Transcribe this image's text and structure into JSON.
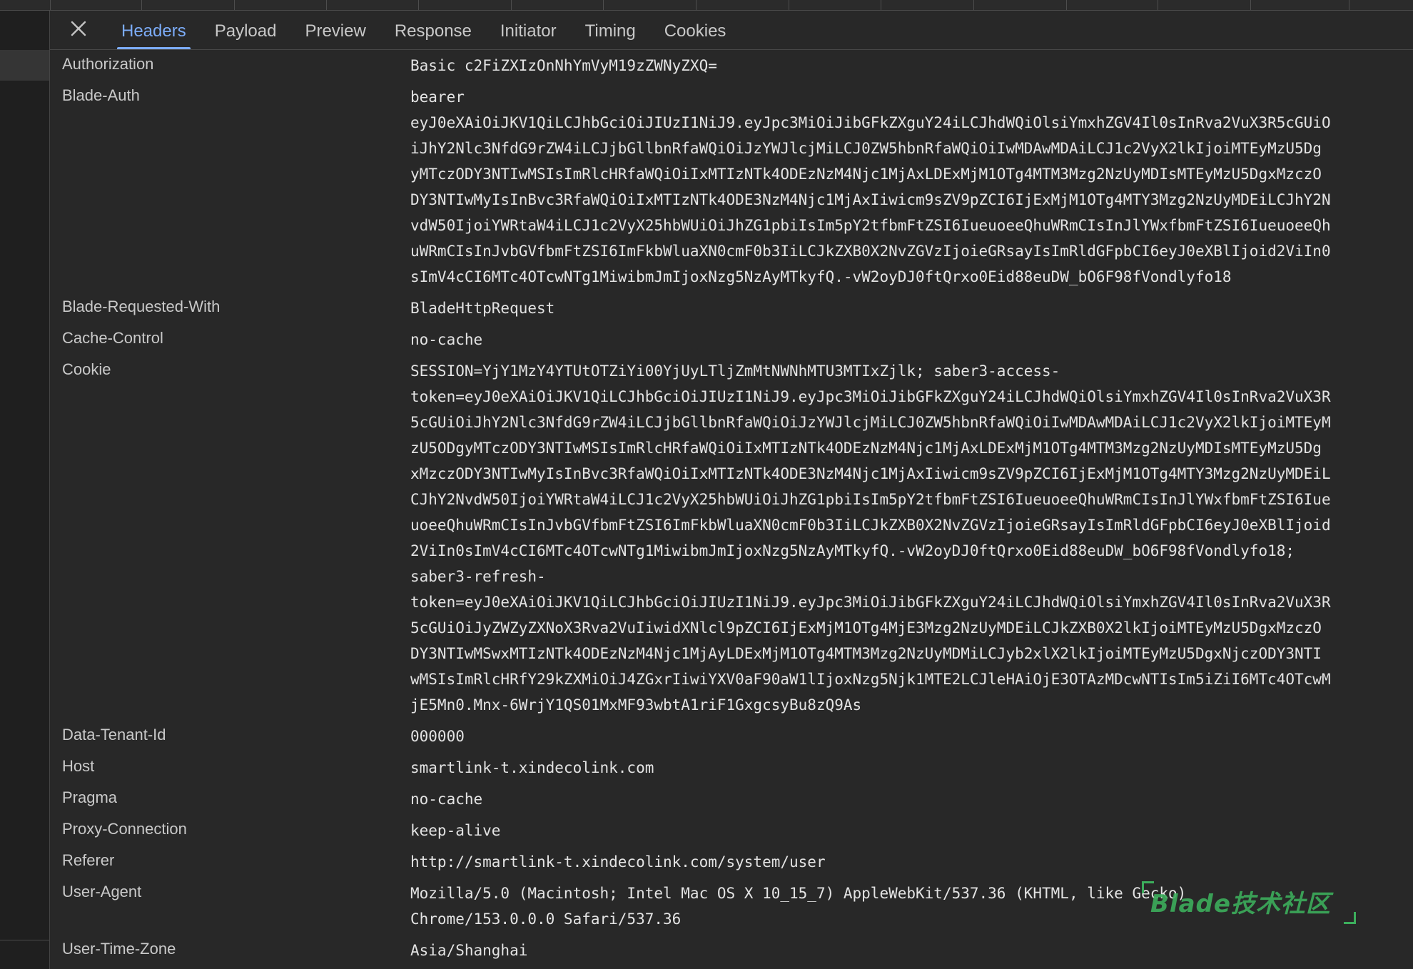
{
  "tabs": {
    "close_label": "×",
    "items": [
      {
        "label": "Headers",
        "active": true
      },
      {
        "label": "Payload",
        "active": false
      },
      {
        "label": "Preview",
        "active": false
      },
      {
        "label": "Response",
        "active": false
      },
      {
        "label": "Initiator",
        "active": false
      },
      {
        "label": "Timing",
        "active": false
      },
      {
        "label": "Cookies",
        "active": false
      }
    ]
  },
  "headers": [
    {
      "name": "Authorization",
      "lines": [
        "Basic c2FiZXIzOnNhYmVyM19zZWNyZXQ="
      ]
    },
    {
      "name": "Blade-Auth",
      "lines": [
        "bearer",
        "eyJ0eXAiOiJKV1QiLCJhbGciOiJIUzI1NiJ9.eyJpc3MiOiJibGFkZXguY24iLCJhdWQiOlsiYmxhZGV4Il0sInRva2VuX3R5cGUiO",
        "iJhY2Nlc3NfdG9rZW4iLCJjbGllbnRfaWQiOiJzYWJlcjMiLCJ0ZW5hbnRfaWQiOiIwMDAwMDAiLCJ1c2VyX2lkIjoiMTEyMzU5Dg",
        "yMTczODY3NTIwMSIsImRlcHRfaWQiOiIxMTIzNTk4ODEzNzM4Njc1MjAxLDExMjM1OTg4MTM3Mzg2NzUyMDIsMTEyMzU5DgxMzczO",
        "DY3NTIwMyIsInBvc3RfaWQiOiIxMTIzNTk4ODE3NzM4Njc1MjAxIiwicm9sZV9pZCI6IjExMjM1OTg4MTY3Mzg2NzUyMDEiLCJhY2N",
        "vdW50IjoiYWRtaW4iLCJ1c2VyX25hbWUiOiJhZG1pbiIsIm5pY2tfbmFtZSI6IueuoeeQhuWRmCIsInJlYWxfbmFtZSI6IueuoeeQh",
        "uWRmCIsInJvbGVfbmFtZSI6ImFkbWluaXN0cmF0b3IiLCJkZXB0X2NvZGVzIjoieGRsayIsImRldGFpbCI6eyJ0eXBlIjoid2ViIn0",
        "sImV4cCI6MTc4OTcwNTg1MiwibmJmIjoxNzg5NzAyMTkyfQ.-vW2oyDJ0ftQrxo0Eid88euDW_bO6F98fVondlyfo18"
      ]
    },
    {
      "name": "Blade-Requested-With",
      "lines": [
        "BladeHttpRequest"
      ]
    },
    {
      "name": "Cache-Control",
      "lines": [
        "no-cache"
      ]
    },
    {
      "name": "Cookie",
      "lines": [
        "SESSION=YjY1MzY4YTUtOTZiYi00YjUyLTljZmMtNWNhMTU3MTIxZjlk; saber3-access-",
        "token=eyJ0eXAiOiJKV1QiLCJhbGciOiJIUzI1NiJ9.eyJpc3MiOiJibGFkZXguY24iLCJhdWQiOlsiYmxhZGV4Il0sInRva2VuX3R",
        "5cGUiOiJhY2Nlc3NfdG9rZW4iLCJjbGllbnRfaWQiOiJzYWJlcjMiLCJ0ZW5hbnRfaWQiOiIwMDAwMDAiLCJ1c2VyX2lkIjoiMTEyM",
        "zU5ODgyMTczODY3NTIwMSIsImRlcHRfaWQiOiIxMTIzNTk4ODEzNzM4Njc1MjAxLDExMjM1OTg4MTM3Mzg2NzUyMDIsMTEyMzU5Dg",
        "xMzczODY3NTIwMyIsInBvc3RfaWQiOiIxMTIzNTk4ODE3NzM4Njc1MjAxIiwicm9sZV9pZCI6IjExMjM1OTg4MTY3Mzg2NzUyMDEiL",
        "CJhY2NvdW50IjoiYWRtaW4iLCJ1c2VyX25hbWUiOiJhZG1pbiIsIm5pY2tfbmFtZSI6IueuoeeQhuWRmCIsInJlYWxfbmFtZSI6Iue",
        "uoeeQhuWRmCIsInJvbGVfbmFtZSI6ImFkbWluaXN0cmF0b3IiLCJkZXB0X2NvZGVzIjoieGRsayIsImRldGFpbCI6eyJ0eXBlIjoid",
        "2ViIn0sImV4cCI6MTc4OTcwNTg1MiwibmJmIjoxNzg5NzAyMTkyfQ.-vW2oyDJ0ftQrxo0Eid88euDW_bO6F98fVondlyfo18;",
        "saber3-refresh-",
        "token=eyJ0eXAiOiJKV1QiLCJhbGciOiJIUzI1NiJ9.eyJpc3MiOiJibGFkZXguY24iLCJhdWQiOlsiYmxhZGV4Il0sInRva2VuX3R",
        "5cGUiOiJyZWZyZXNoX3Rva2VuIiwidXNlcl9pZCI6IjExMjM1OTg4MjE3Mzg2NzUyMDEiLCJkZXB0X2lkIjoiMTEyMzU5DgxMzczO",
        "DY3NTIwMSwxMTIzNTk4ODEzNzM4Njc1MjAyLDExMjM1OTg4MTM3Mzg2NzUyMDMiLCJyb2xlX2lkIjoiMTEyMzU5DgxNjczODY3NTI",
        "wMSIsImRlcHRfY29kZXMiOiJ4ZGxrIiwiYXV0aF90aW1lIjoxNzg5Njk1MTE2LCJleHAiOjE3OTAzMDcwNTIsIm5iZiI6MTc4OTcwM",
        "jE5Mn0.Mnx-6WrjY1QS01MxMF93wbtA1riF1GxgcsyBu8zQ9As"
      ]
    },
    {
      "name": "Data-Tenant-Id",
      "lines": [
        "000000"
      ]
    },
    {
      "name": "Host",
      "lines": [
        "smartlink-t.xindecolink.com"
      ]
    },
    {
      "name": "Pragma",
      "lines": [
        "no-cache"
      ]
    },
    {
      "name": "Proxy-Connection",
      "lines": [
        "keep-alive"
      ]
    },
    {
      "name": "Referer",
      "lines": [
        "http://smartlink-t.xindecolink.com/system/user"
      ]
    },
    {
      "name": "User-Agent",
      "lines": [
        "Mozilla/5.0 (Macintosh; Intel Mac OS X 10_15_7) AppleWebKit/537.36 (KHTML, like Gecko)",
        "Chrome/153.0.0.0 Safari/537.36"
      ]
    },
    {
      "name": "User-Time-Zone",
      "lines": [
        "Asia/Shanghai"
      ]
    }
  ],
  "watermark": {
    "text": "Blade技术社区"
  },
  "colors": {
    "background": "#282828",
    "tab_active": "#7cacf8",
    "watermark": "#3cae5c"
  }
}
